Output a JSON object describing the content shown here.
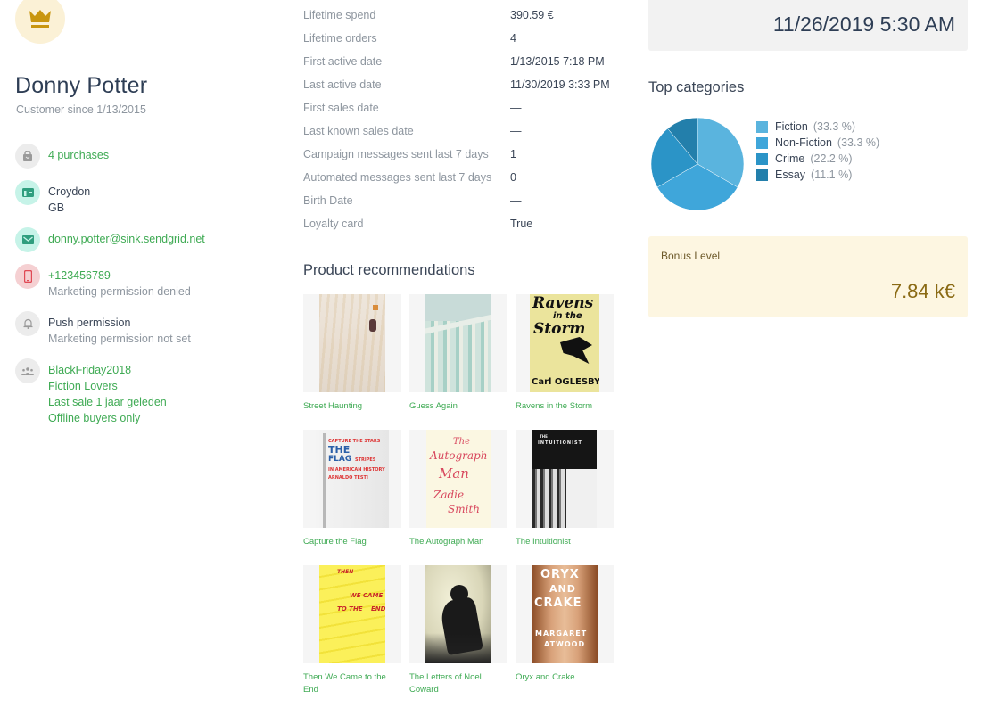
{
  "customer": {
    "name": "Donny Potter",
    "since": "Customer since 1/13/2015",
    "avatar_icon": "crown-icon"
  },
  "info": {
    "purchases": "4 purchases",
    "city": "Croydon",
    "country": "GB",
    "email": "donny.potter@sink.sendgrid.net",
    "phone": "+123456789",
    "phone_permission": "Marketing permission denied",
    "push_label": "Push permission",
    "push_permission": "Marketing permission not set",
    "segments": [
      "BlackFriday2018",
      "Fiction Lovers",
      "Last sale 1 jaar geleden",
      "Offline buyers only"
    ]
  },
  "stats": [
    {
      "label": "Lifetime spend",
      "value": "390.59 €"
    },
    {
      "label": "Lifetime orders",
      "value": "4"
    },
    {
      "label": "First active date",
      "value": "1/13/2015 7:18 PM"
    },
    {
      "label": "Last active date",
      "value": "11/30/2019 3:33 PM"
    },
    {
      "label": "First sales date",
      "value": "—"
    },
    {
      "label": "Last known sales date",
      "value": "—"
    },
    {
      "label": "Campaign messages sent last 7 days",
      "value": "1"
    },
    {
      "label": "Automated messages sent last 7 days",
      "value": "0"
    },
    {
      "label": "Birth Date",
      "value": "—"
    },
    {
      "label": "Loyalty card",
      "value": "True"
    }
  ],
  "recommendations": {
    "title": "Product recommendations",
    "items": [
      {
        "title": "Street Haunting"
      },
      {
        "title": "Guess Again"
      },
      {
        "title": "Ravens in the Storm"
      },
      {
        "title": "Capture the Flag"
      },
      {
        "title": "The Autograph Man"
      },
      {
        "title": "The Intuitionist"
      },
      {
        "title": "Then We Came to the End"
      },
      {
        "title": "The Letters of Noel Coward"
      },
      {
        "title": "Oryx and Crake"
      }
    ],
    "cover_text": {
      "ravens": [
        "Ravens",
        "in the",
        "Storm",
        "Carl OGLESBY"
      ],
      "flag": [
        "CAPTURE THE STARS",
        "THE",
        "FLAG",
        "STRIPES",
        "IN AMERICAN HISTORY",
        "ARNALDO TESTI"
      ],
      "autograph": [
        "The",
        "Autograph",
        "Man",
        "Zadie",
        "Smith"
      ],
      "intuitionist": [
        "THE",
        "INTUITIONIST"
      ],
      "then_we_came": [
        "THEN",
        "WE CAME",
        "TO THE",
        "END"
      ],
      "oryx": [
        "ORYX",
        "AND",
        "CRAKE",
        "MARGARET",
        "ATWOOD"
      ]
    }
  },
  "header_date": "11/26/2019 5:30 AM",
  "top_categories": {
    "title": "Top categories",
    "legend": [
      {
        "label": "Fiction",
        "pct": "(33.3 %)",
        "color": "#5ab4de"
      },
      {
        "label": "Non-Fiction",
        "pct": "(33.3 %)",
        "color": "#3fa6da"
      },
      {
        "label": "Crime",
        "pct": "(22.2 %)",
        "color": "#2b94c7"
      },
      {
        "label": "Essay",
        "pct": "(11.1 %)",
        "color": "#237fab"
      }
    ]
  },
  "chart_data": {
    "type": "pie",
    "title": "Top categories",
    "categories": [
      "Fiction",
      "Non-Fiction",
      "Crime",
      "Essay"
    ],
    "values": [
      33.3,
      33.3,
      22.2,
      11.1
    ],
    "colors": [
      "#5ab4de",
      "#3fa6da",
      "#2b94c7",
      "#237fab"
    ],
    "legend": "right"
  },
  "bonus": {
    "label": "Bonus Level",
    "value": "7.84 k€"
  },
  "colors": {
    "accent_green": "#3eaa53",
    "crown_gold": "#c9960f",
    "bonus_bg": "#fdf6e1"
  }
}
